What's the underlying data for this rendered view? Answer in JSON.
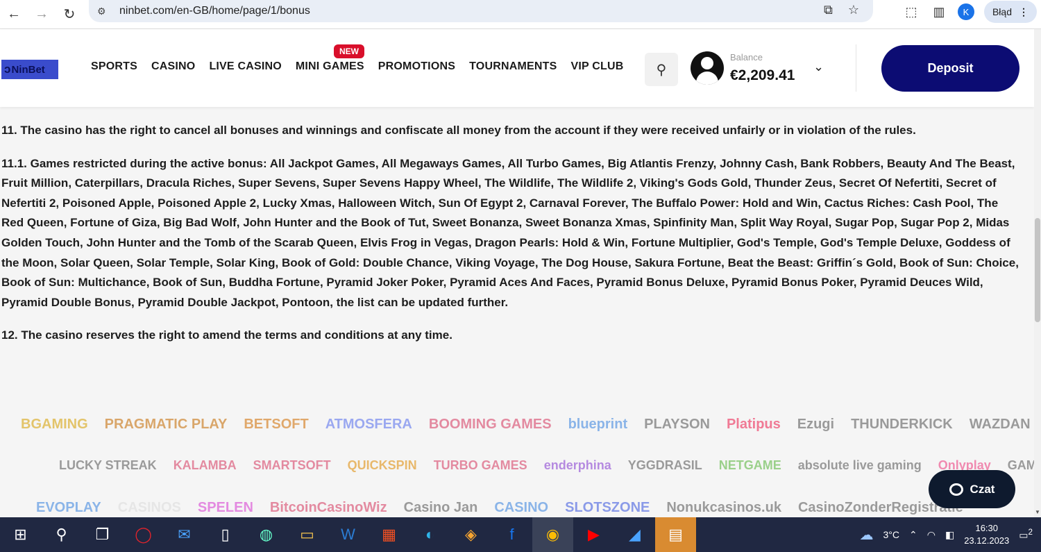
{
  "browser": {
    "url": "ninbet.com/en-GB/home/page/1/bonus",
    "profile_initial": "K",
    "error_label": "Błąd"
  },
  "header": {
    "logo_text": "NinBet",
    "nav": [
      "SPORTS",
      "CASINO",
      "LIVE CASINO",
      "MINI GAMES",
      "PROMOTIONS",
      "TOURNAMENTS",
      "VIP CLUB"
    ],
    "new_badge": "NEW",
    "balance_label": "Balance",
    "balance_value": "€2,209.41",
    "deposit_label": "Deposit"
  },
  "content": {
    "p11": "11. The casino has the right to cancel all bonuses and winnings and confiscate all money from the account if they were received unfairly or in violation of the rules.",
    "p11_1": "11.1. Games restricted during the active bonus: All Jackpot Games, All Megaways Games, All Turbo Games, Big Atlantis Frenzy, Johnny Cash, Bank Robbers, Beauty And The Beast, Fruit Million, Caterpillars, Dracula Riches, Super Sevens, Super Sevens Happy Wheel, The Wildlife, The Wildlife 2, Viking's Gods Gold, Thunder Zeus, Secret Of Nefertiti, Secret of Nefertiti 2, Poisoned Apple, Poisoned Apple 2, Lucky Xmas, Halloween Witch, Sun Of Egypt 2, Carnaval Forever, The Buffalo Power: Hold and Win, Cactus Riches: Cash Pool, The Red Queen, Fortune of Giza, Big Bad Wolf, John Hunter and the Book of Tut, Sweet Bonanza, Sweet Bonanza Xmas, Spinfinity Man, Split Way Royal, Sugar Pop, Sugar Pop 2, Midas Golden Touch, John Hunter and the Tomb of the Scarab Queen, Elvis Frog in Vegas, Dragon Pearls: Hold & Win, Fortune Multiplier, God's Temple, God's Temple Deluxe, Goddess of the Moon, Solar Queen, Solar Temple, Solar King, Book of Gold: Double Chance, Viking Voyage, The Dog House, Sakura Fortune, Beat the Beast: Griffin´s Gold, Book of Sun: Choice, Book of Sun: Multichance, Book of Sun, Buddha Fortune, Pyramid Joker Poker, Pyramid Aces And Faces, Pyramid Bonus Deluxe, Pyramid Bonus Poker, Pyramid Deuces Wild, Pyramid Double Bonus, Pyramid Double Jackpot, Pontoon, the list can be updated further.",
    "p12": "12. The casino reserves the right to amend the terms and conditions at any time."
  },
  "providers": {
    "row1": [
      {
        "name": "BGAMING",
        "color": "#e3c46a"
      },
      {
        "name": "PRAGMATIC PLAY",
        "color": "#d9a66a"
      },
      {
        "name": "BETSOFT",
        "color": "#e0a86b"
      },
      {
        "name": "ATMOSFERA",
        "color": "#9aa8f0"
      },
      {
        "name": "BOOMING GAMES",
        "color": "#e38aa0"
      },
      {
        "name": "blueprint",
        "color": "#8ab4e8"
      },
      {
        "name": "PLAYSON",
        "color": "#9a9a9a"
      },
      {
        "name": "Platipus",
        "color": "#f07a95"
      },
      {
        "name": "Ezugi",
        "color": "#9a9a9a"
      },
      {
        "name": "THUNDERKICK",
        "color": "#9a9a9a"
      },
      {
        "name": "WAZDAN",
        "color": "#9a9a9a"
      }
    ],
    "row2": [
      {
        "name": "LUCKY STREAK",
        "color": "#9a9a9a"
      },
      {
        "name": "KALAMBA",
        "color": "#e38aa0"
      },
      {
        "name": "SMARTSOFT",
        "color": "#e38aa0"
      },
      {
        "name": "QUICKSPIN",
        "color": "#e8b86b"
      },
      {
        "name": "TURBO GAMES",
        "color": "#e38aa0"
      },
      {
        "name": "enderphina",
        "color": "#b58ae0"
      },
      {
        "name": "YGGDRASIL",
        "color": "#9a9a9a"
      },
      {
        "name": "NETGAME",
        "color": "#9ad08a"
      },
      {
        "name": "absolute live gaming",
        "color": "#9a9a9a"
      },
      {
        "name": "Onlyplay",
        "color": "#f08ab0"
      },
      {
        "name": "GAMEBEAT",
        "color": "#9a9a9a"
      }
    ],
    "row3": [
      {
        "name": "EVOPLAY",
        "color": "#8ab4e8"
      },
      {
        "name": "CASINOS",
        "color": "#e6e6e6"
      },
      {
        "name": "SPELEN",
        "color": "#e38ae0"
      },
      {
        "name": "BitcoinCasinoWiz",
        "color": "#e38aa0"
      },
      {
        "name": "Casino Jan",
        "color": "#9a9a9a"
      },
      {
        "name": "CASINO",
        "color": "#8ab4e8"
      },
      {
        "name": "SLOTSZONE",
        "color": "#8a9ae8"
      },
      {
        "name": "Nonukcasinos.uk",
        "color": "#9a9a9a"
      },
      {
        "name": "CasinoZonderRegistratie",
        "color": "#9a9a9a"
      }
    ]
  },
  "chat": {
    "label": "Czat"
  },
  "taskbar": {
    "weather": "3°C",
    "time": "16:30",
    "date": "23.12.2023",
    "notifications": "2"
  },
  "icons": {
    "back": "back-arrow-icon",
    "forward": "forward-arrow-icon",
    "reload": "reload-icon",
    "search": "search-icon",
    "user": "user-avatar-icon",
    "chevron": "chevron-down-icon",
    "chat": "chat-bubble-icon"
  },
  "colors": {
    "deposit": "#0c0c73",
    "new_badge": "#d90f2b",
    "chat_btn": "#0e1a2e",
    "taskbar": "#202842"
  }
}
